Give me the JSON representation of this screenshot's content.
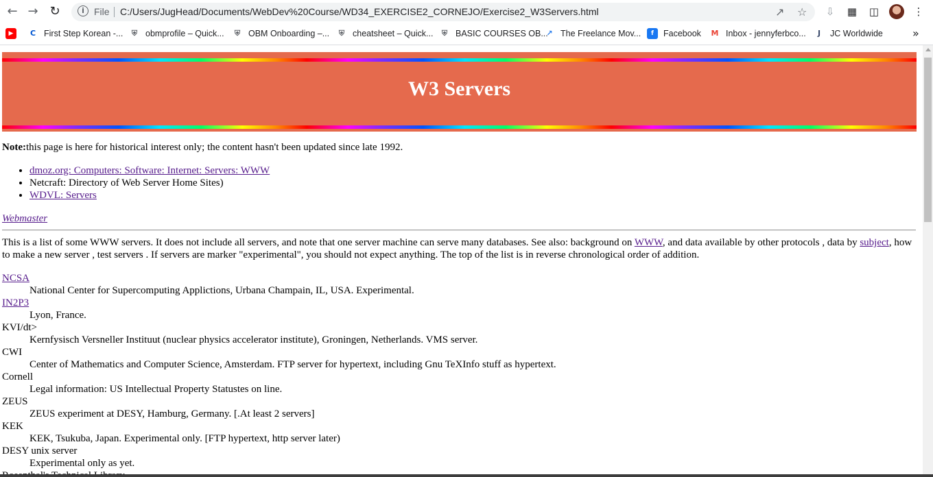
{
  "browser": {
    "scheme_label": "File",
    "url": "C:/Users/JugHead/Documents/WebDev%20Course/WD34_EXERCISE2_CORNEJO/Exercise2_W3Servers.html",
    "bookmarks": [
      {
        "label": "",
        "icon": "youtube-icon",
        "color": "#ff0000"
      },
      {
        "label": "First Step Korean -...",
        "icon": "coursera-icon",
        "color": "#0056d2"
      },
      {
        "label": "obmprofile – Quick...",
        "icon": "shield-icon",
        "color": "#5f6368"
      },
      {
        "label": "OBM Onboarding –...",
        "icon": "shield-icon",
        "color": "#5f6368"
      },
      {
        "label": "cheatsheet – Quick...",
        "icon": "shield-icon",
        "color": "#5f6368"
      },
      {
        "label": "BASIC COURSES OB...",
        "icon": "shield-icon",
        "color": "#5f6368"
      },
      {
        "label": "The Freelance Mov...",
        "icon": "freelance-icon",
        "color": "#2f80ed"
      },
      {
        "label": "Facebook",
        "icon": "facebook-icon",
        "color": "#1877f2"
      },
      {
        "label": "Inbox - jennyferbco...",
        "icon": "gmail-icon",
        "color": "#ea4335"
      },
      {
        "label": "JC Worldwide",
        "icon": "jc-icon",
        "color": "#3b4a6b"
      }
    ],
    "more_bookmarks": "»"
  },
  "page": {
    "title": "W3 Servers",
    "note_label": "Note:",
    "note_text": "this page is here for historical interest only; the content hasn't been updated since late 1992.",
    "links": [
      {
        "text": "dmoz.org: Computers: Software: Internet: Servers: WWW",
        "is_link": true
      },
      {
        "text": "Netcraft: Directory of Web Server Home Sites)",
        "is_link": false
      },
      {
        "text": "WDVL: Servers",
        "is_link": true
      }
    ],
    "webmaster": "Webmaster",
    "intro": {
      "part1": "This is a list of some WWW servers. It does not include all servers, and note that one server machine can serve many databases. See also: background on ",
      "link_www": "WWW",
      "part2": ", and data available by other protocols , data by ",
      "link_subject": "subject",
      "part3": ", how to make a new server , test servers . If servers are marker \"experimental\", you should not expect anything. The top of the list is in reverse chronological order of addition."
    },
    "servers": [
      {
        "name": "NCSA",
        "is_link": true,
        "desc": "National Center for Supercomputing Applictions, Urbana Champain, IL, USA. Experimental."
      },
      {
        "name": "IN2P3",
        "is_link": true,
        "desc": "Lyon, France."
      },
      {
        "name": "KVI/dt>",
        "is_link": false,
        "desc": "Kernfysisch Versneller Instituut (nuclear physics accelerator institute), Groningen, Netherlands. VMS server."
      },
      {
        "name": "CWI",
        "is_link": false,
        "desc": "Center of Mathematics and Computer Science, Amsterdam. FTP server for hypertext, including Gnu TeXInfo stuff as hypertext."
      },
      {
        "name": "Cornell",
        "is_link": false,
        "desc": "Legal information: US Intellectual Property Statustes on line."
      },
      {
        "name": "ZEUS",
        "is_link": false,
        "desc": "ZEUS experiment at DESY, Hamburg, Germany. [.At least 2 servers]"
      },
      {
        "name": "KEK",
        "is_link": false,
        "desc": "KEK, Tsukuba, Japan. Experimental only. [FTP hypertext, http server later)"
      },
      {
        "name": "DESY unix server",
        "is_link": false,
        "desc": "Experimental only as yet."
      },
      {
        "name": "Rosenthal's Technical Library",
        "is_link": false,
        "desc": ""
      }
    ]
  }
}
